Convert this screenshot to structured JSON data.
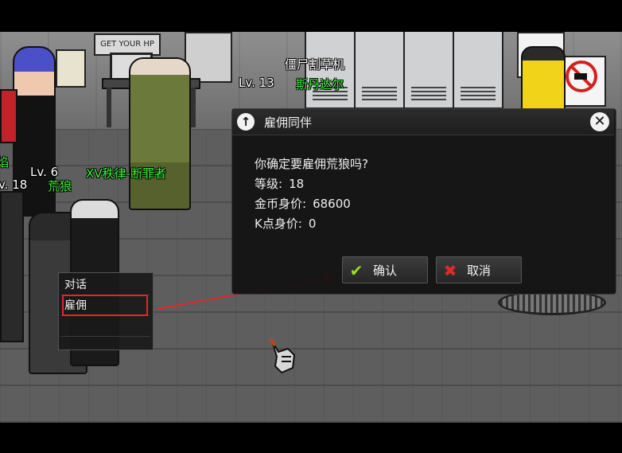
{
  "scene": {
    "npc_top": {
      "name": "僵尸割草机",
      "level": "Lv. 13",
      "title": "斯丹达尔"
    },
    "npc_left": {
      "level_partial": "Lv. 6",
      "title": "XV秩律-断罪者",
      "level_partial2": "v. 18",
      "name_partial": "荒狼",
      "edge_partial": "焰"
    },
    "poster_text": "GET YOUR HP"
  },
  "context_menu": {
    "items": [
      "对话",
      "雇佣",
      ""
    ]
  },
  "dialog": {
    "title": "雇佣同伴",
    "question": "你确定要雇佣荒狼吗?",
    "level_label": "等级:",
    "level_value": "18",
    "gold_label": "金币身价:",
    "gold_value": "68600",
    "k_label": "K点身价:",
    "k_value": "0",
    "confirm_label": "确认",
    "cancel_label": "取消"
  },
  "colors": {
    "accent_green": "#3df23d",
    "highlight_red": "#e0282c",
    "confirm_icon": "#9be021",
    "cancel_icon": "#e02a2a"
  },
  "icons": {
    "back": "arrow-up-icon",
    "close": "close-icon",
    "confirm": "checkmark-icon",
    "cancel": "x-icon",
    "cursor": "hand-cursor-icon"
  }
}
